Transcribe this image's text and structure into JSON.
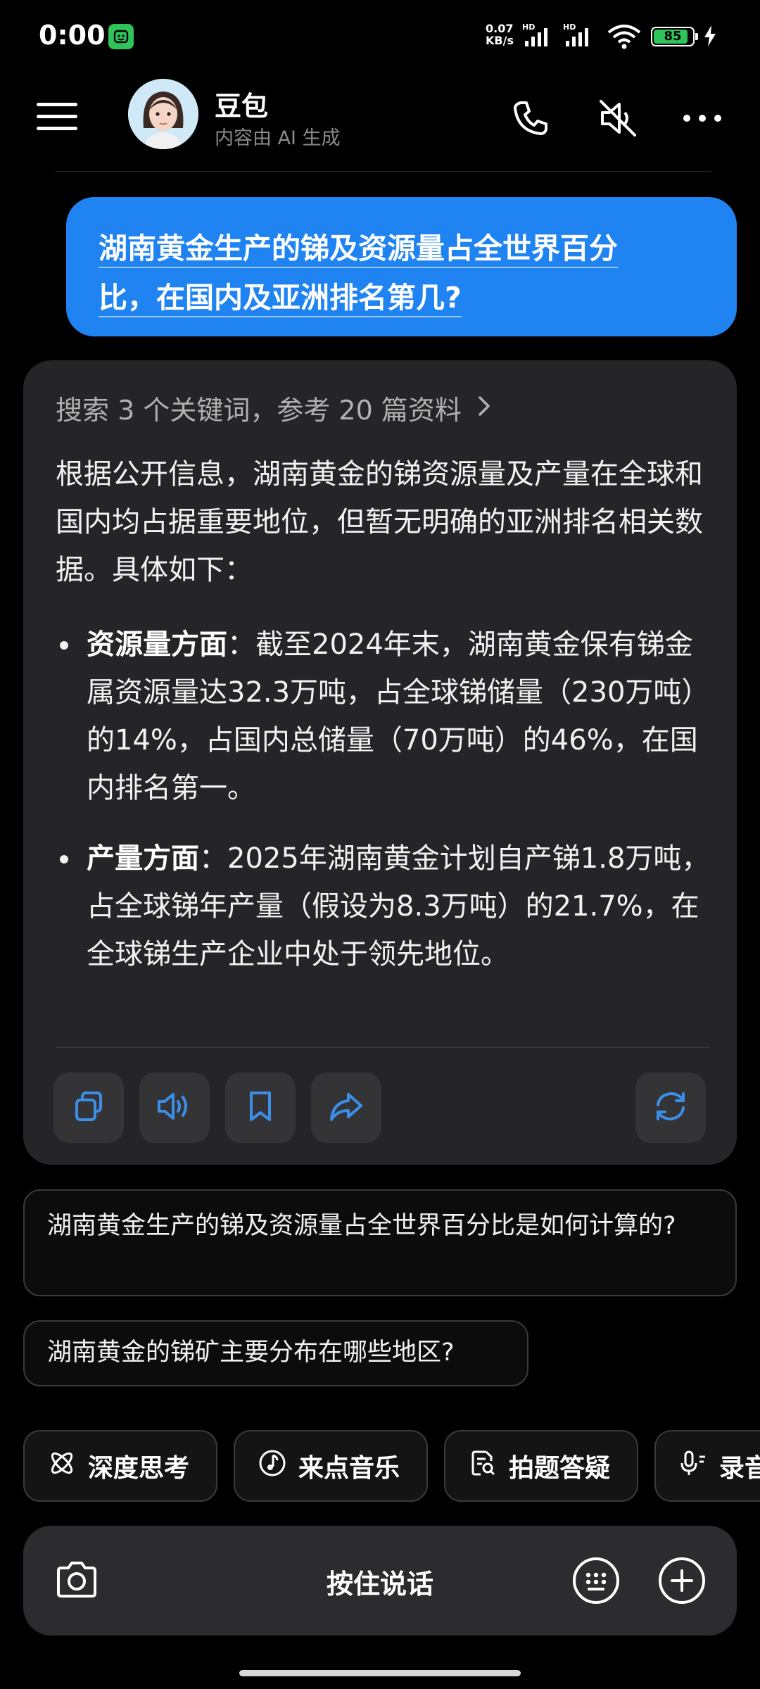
{
  "status_bar": {
    "time": "0:00",
    "net_speed_value": "0.07",
    "net_speed_unit": "KB/s",
    "signal_labels": [
      "HD",
      "HD"
    ],
    "battery_level": "85",
    "battery_color": "#2fc35a",
    "icons": [
      "mi-home-icon",
      "signal-icon",
      "signal-icon",
      "wifi-icon",
      "battery-icon",
      "charging-icon"
    ]
  },
  "header": {
    "bot_name": "豆包",
    "subtitle": "内容由 AI 生成",
    "icons": [
      "menu-icon",
      "phone-icon",
      "speaker-muted-icon",
      "more-icon"
    ]
  },
  "user_message": {
    "line1": "湖南黄金生产的锑及资源量占全世界百分",
    "line2": "比，在国内及亚洲排名第几?"
  },
  "answer": {
    "search_summary": "搜索 3 个关键词，参考 20 篇资料",
    "intro": "根据公开信息，湖南黄金的锑资源量及产量在全球和国内均占据重要地位，但暂无明确的亚洲排名相关数据。具体如下：",
    "bullets": [
      {
        "title": "资源量方面",
        "text": "：截至2024年末，湖南黄金保有锑金属资源量达32.3万吨，占全球锑储量（230万吨）的14%，占国内总储量（70万吨）的46%，在国内排名第一。"
      },
      {
        "title": "产量方面",
        "text": "：2025年湖南黄金计划自产锑1.8万吨，占全球锑年产量（假设为8.3万吨）的21.7%，在全球锑生产企业中处于领先地位。"
      }
    ],
    "actions": [
      "copy-icon",
      "read-aloud-icon",
      "bookmark-icon",
      "share-icon",
      "regenerate-icon"
    ],
    "accent_color": "#3b8fe8"
  },
  "suggestions": [
    "湖南黄金生产的锑及资源量占全世界百分比是如何计算的?",
    "湖南黄金的锑矿主要分布在哪些地区?"
  ],
  "chips": [
    {
      "label": "深度思考",
      "icon": "atom-icon"
    },
    {
      "label": "来点音乐",
      "icon": "music-icon"
    },
    {
      "label": "拍题答疑",
      "icon": "scan-question-icon"
    },
    {
      "label": "录音",
      "icon": "mic-icon"
    }
  ],
  "input_bar": {
    "hold_to_talk": "按住说话",
    "icons": [
      "camera-icon",
      "keyboard-icon",
      "plus-icon"
    ]
  }
}
